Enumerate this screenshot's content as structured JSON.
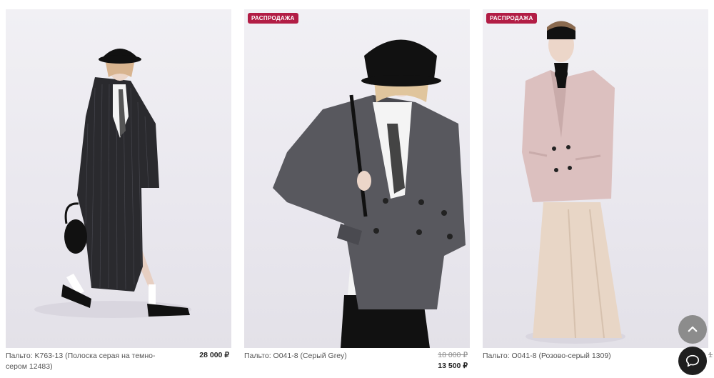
{
  "products": [
    {
      "title": "Пальто: K763-13 (Полоска серая на темно-сером 12483)",
      "price": "28 000 ₽",
      "badge": "",
      "colors": {
        "coat": "#2a2a2e",
        "accent": "#1c1c1f"
      }
    },
    {
      "title": "Пальто: O041-8 (Серый Grey)",
      "old_price": "18 000 ₽",
      "new_price": "13 500 ₽",
      "badge": "РАСПРОДАЖА",
      "colors": {
        "coat": "#58585e",
        "accent": "#111111"
      }
    },
    {
      "title": "Пальто: O041-8 (Розово-серый 1309)",
      "old_price": "1",
      "badge": "РАСПРОДАЖА",
      "colors": {
        "coat": "#dcc0bf",
        "accent": "#e8d6c6"
      }
    }
  ],
  "buttons": {
    "scroll_top_icon": "chevron-up-icon",
    "chat_icon": "chat-bubble-icon"
  },
  "colors": {
    "sale_badge": "#b21d45",
    "scroll_top_bg": "#8c8c8c",
    "chat_bg": "#1f1f1f"
  }
}
